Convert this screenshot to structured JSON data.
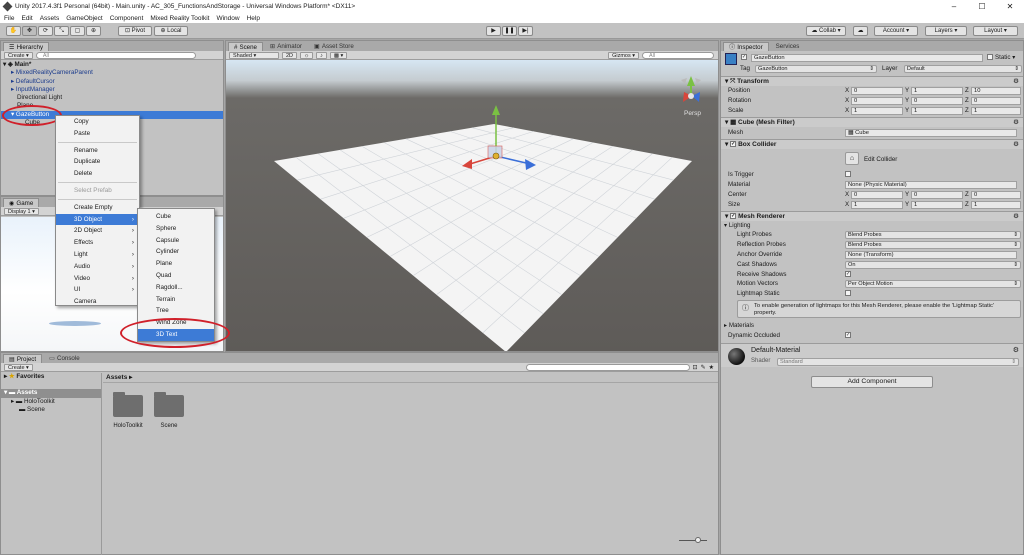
{
  "window": {
    "title": "Unity 2017.4.3f1 Personal (64bit) - Main.unity - AC_305_FunctionsAndStorage - Universal Windows Platform* <DX11>",
    "controls": [
      "–",
      "☐",
      "✕"
    ]
  },
  "menu": [
    "File",
    "Edit",
    "Assets",
    "GameObject",
    "Component",
    "Mixed Reality Toolkit",
    "Window",
    "Help"
  ],
  "toolbar": {
    "pivot": "Pivot",
    "local": "Local",
    "collab": "Collab",
    "account": "Account",
    "layers": "Layers",
    "layout": "Layout"
  },
  "hierarchy": {
    "tab": "Hierarchy",
    "create": "Create",
    "search_placeholder": "All",
    "scene": "Main*",
    "items": [
      {
        "label": "MixedRealityCameraParent",
        "prefab": true
      },
      {
        "label": "DefaultCursor",
        "prefab": true
      },
      {
        "label": "InputManager",
        "prefab": true
      },
      {
        "label": "Directional Light",
        "prefab": false
      },
      {
        "label": "Plane",
        "prefab": false
      },
      {
        "label": "GazeButton",
        "prefab": false,
        "selected": true
      },
      {
        "label": "Cube",
        "prefab": false
      }
    ]
  },
  "context_menu": {
    "items": [
      {
        "label": "Copy"
      },
      {
        "label": "Paste"
      },
      {
        "sep": true
      },
      {
        "label": "Rename"
      },
      {
        "label": "Duplicate"
      },
      {
        "label": "Delete"
      },
      {
        "sep": true
      },
      {
        "label": "Select Prefab",
        "disabled": true
      },
      {
        "sep": true
      },
      {
        "label": "Create Empty"
      },
      {
        "label": "3D Object",
        "sub": true,
        "selected": true
      },
      {
        "label": "2D Object",
        "sub": true
      },
      {
        "label": "Effects",
        "sub": true
      },
      {
        "label": "Light",
        "sub": true
      },
      {
        "label": "Audio",
        "sub": true
      },
      {
        "label": "Video",
        "sub": true
      },
      {
        "label": "UI",
        "sub": true
      },
      {
        "label": "Camera"
      }
    ]
  },
  "submenu": {
    "items": [
      {
        "label": "Cube"
      },
      {
        "label": "Sphere"
      },
      {
        "label": "Capsule"
      },
      {
        "label": "Cylinder"
      },
      {
        "label": "Plane"
      },
      {
        "label": "Quad"
      },
      {
        "label": "Ragdoll..."
      },
      {
        "label": "Terrain"
      },
      {
        "label": "Tree"
      },
      {
        "label": "Wind Zone"
      },
      {
        "label": "3D Text",
        "selected": true
      }
    ]
  },
  "game": {
    "tab": "Game",
    "display": "Display 1"
  },
  "scene": {
    "tabs": [
      "Scene",
      "Animator",
      "Asset Store"
    ],
    "shaded": "Shaded",
    "mode2d": "2D",
    "gizmos": "Gizmos",
    "search_placeholder": "All",
    "persp": "Persp"
  },
  "inspector": {
    "tabs": [
      "Inspector",
      "Services"
    ],
    "object_name": "GazeButton",
    "static_label": "Static",
    "tag_label": "Tag",
    "tag_value": "GazeButton",
    "layer_label": "Layer",
    "layer_value": "Default",
    "transform": {
      "header": "Transform",
      "position_label": "Position",
      "rotation_label": "Rotation",
      "scale_label": "Scale",
      "position": [
        "0",
        "1",
        "10"
      ],
      "rotation": [
        "0",
        "0",
        "0"
      ],
      "scale": [
        "1",
        "1",
        "1"
      ]
    },
    "mesh_filter": {
      "header": "Cube (Mesh Filter)",
      "mesh_label": "Mesh",
      "mesh_value": "Cube"
    },
    "box_collider": {
      "header": "Box Collider",
      "edit_label": "Edit Collider",
      "trigger_label": "Is Trigger",
      "material_label": "Material",
      "material_value": "None (Physic Material)",
      "center_label": "Center",
      "size_label": "Size",
      "center": [
        "0",
        "0",
        "0"
      ],
      "size": [
        "1",
        "1",
        "1"
      ]
    },
    "mesh_renderer": {
      "header": "Mesh Renderer",
      "lighting": "Lighting",
      "rows": [
        {
          "label": "Light Probes",
          "value": "Blend Probes"
        },
        {
          "label": "Reflection Probes",
          "value": "Blend Probes"
        },
        {
          "label": "Anchor Override",
          "value": "None (Transform)"
        },
        {
          "label": "Cast Shadows",
          "value": "On"
        }
      ],
      "receive_shadows": "Receive Shadows",
      "motion_vectors_label": "Motion Vectors",
      "motion_vectors_value": "Per Object Motion",
      "lightmap_static": "Lightmap Static",
      "info": "To enable generation of lightmaps for this Mesh Renderer, please enable the 'Lightmap Static' property.",
      "materials": "Materials",
      "dynamic_occluded": "Dynamic Occluded"
    },
    "material": {
      "name": "Default-Material",
      "shader_label": "Shader",
      "shader_value": "Standard"
    },
    "axes": [
      "X",
      "Y",
      "Z"
    ],
    "add_component": "Add Component"
  },
  "project": {
    "tabs": [
      "Project",
      "Console"
    ],
    "create": "Create",
    "favorites": "Favorites",
    "assets": "Assets",
    "tree": [
      "HoloToolkit",
      "Scene"
    ],
    "breadcrumb": "Assets",
    "folders": [
      "HoloToolkit",
      "Scene"
    ]
  }
}
